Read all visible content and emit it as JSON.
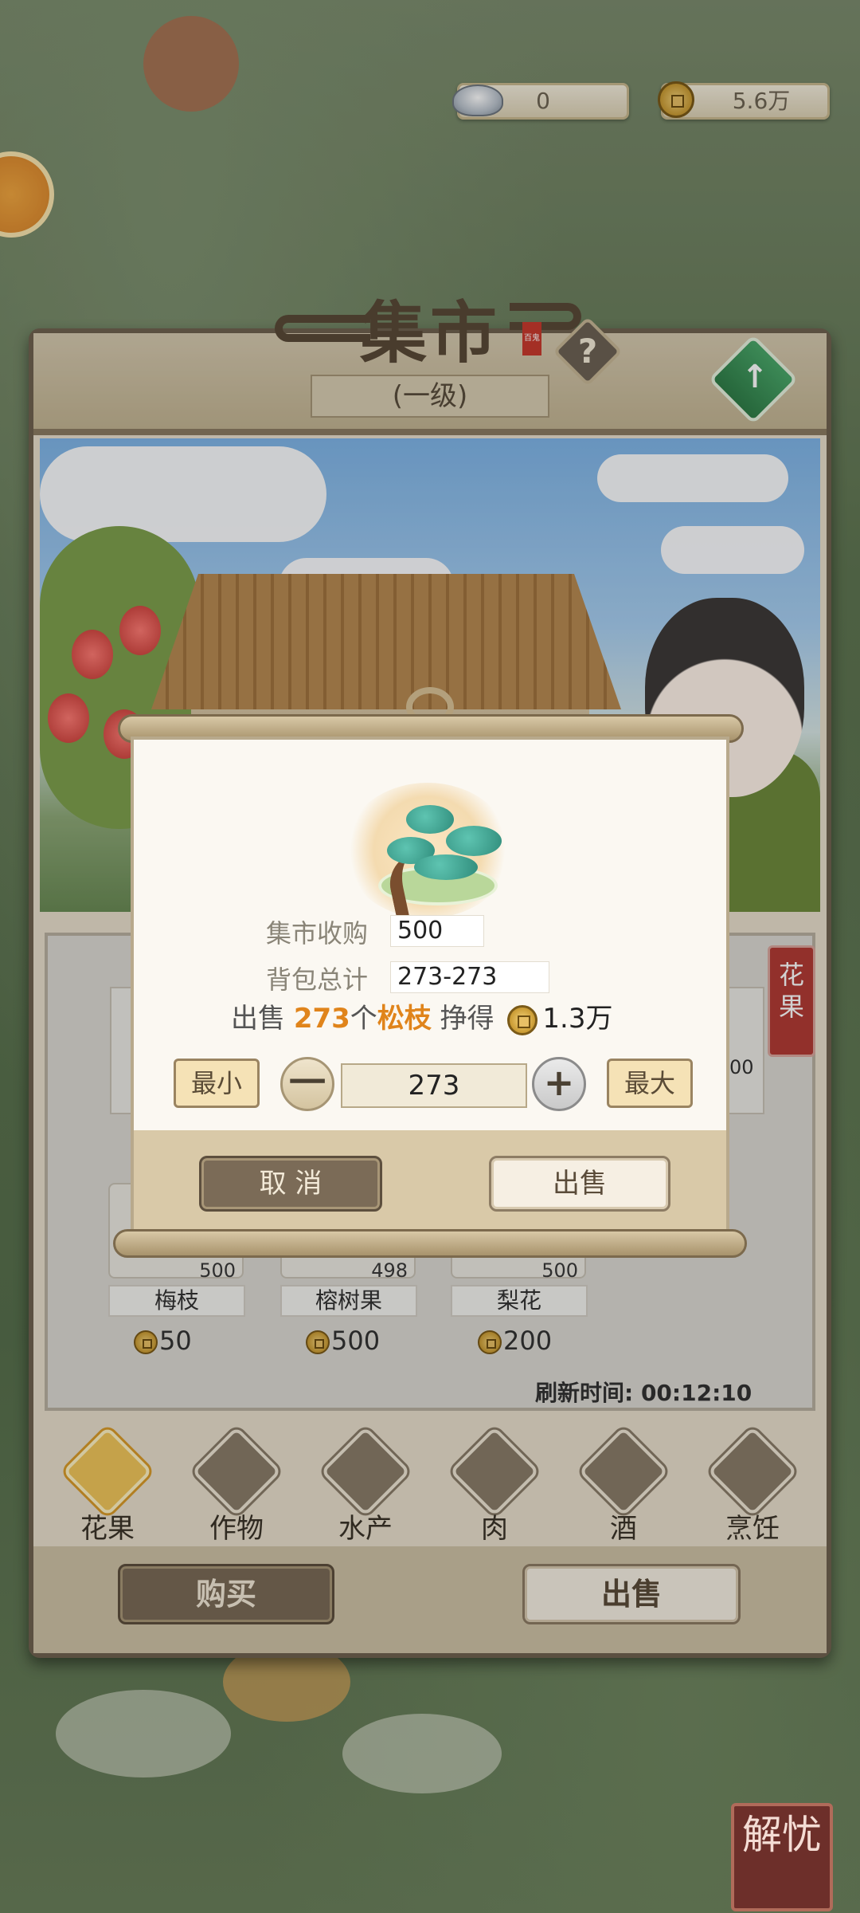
{
  "currencies": {
    "silver": "0",
    "coins": "5.6万"
  },
  "market": {
    "title": "集市",
    "seal": "百鬼",
    "help_icon": "?",
    "level": "(一级)",
    "category_ribbon": "花果"
  },
  "items": [
    {
      "name": "梅枝",
      "qty": "500",
      "price": "50"
    },
    {
      "name": "榕树果",
      "qty": "498",
      "price": "500"
    },
    {
      "name": "梨花",
      "qty": "500",
      "price": "200"
    }
  ],
  "partial_item_qty": "00",
  "refresh": "刷新时间: 00:12:10",
  "tabs": [
    {
      "label": "花果",
      "icon": "fruit-icon",
      "active": true
    },
    {
      "label": "作物",
      "icon": "crop-icon",
      "active": false
    },
    {
      "label": "水产",
      "icon": "seafood-icon",
      "active": false
    },
    {
      "label": "肉",
      "icon": "meat-icon",
      "active": false
    },
    {
      "label": "酒",
      "icon": "wine-icon",
      "active": false
    },
    {
      "label": "烹饪",
      "icon": "cooking-icon",
      "active": false
    }
  ],
  "bottom_buttons": {
    "buy": "购买",
    "sell": "出售"
  },
  "sell_dialog": {
    "market_buy_label": "集市收购",
    "market_buy_value": "500",
    "bag_total_label": "背包总计",
    "bag_total_value": "273-273",
    "sell_prefix": "出售",
    "sell_count": "273",
    "sell_unit": "个",
    "item_name": "松枝",
    "earn_label": "挣得",
    "earn_amount": "1.3万",
    "min_label": "最小",
    "max_label": "最大",
    "minus": "一",
    "plus": "+",
    "quantity": "273",
    "cancel_label": "取 消",
    "confirm_label": "出售"
  },
  "corner_badge": "解忧"
}
